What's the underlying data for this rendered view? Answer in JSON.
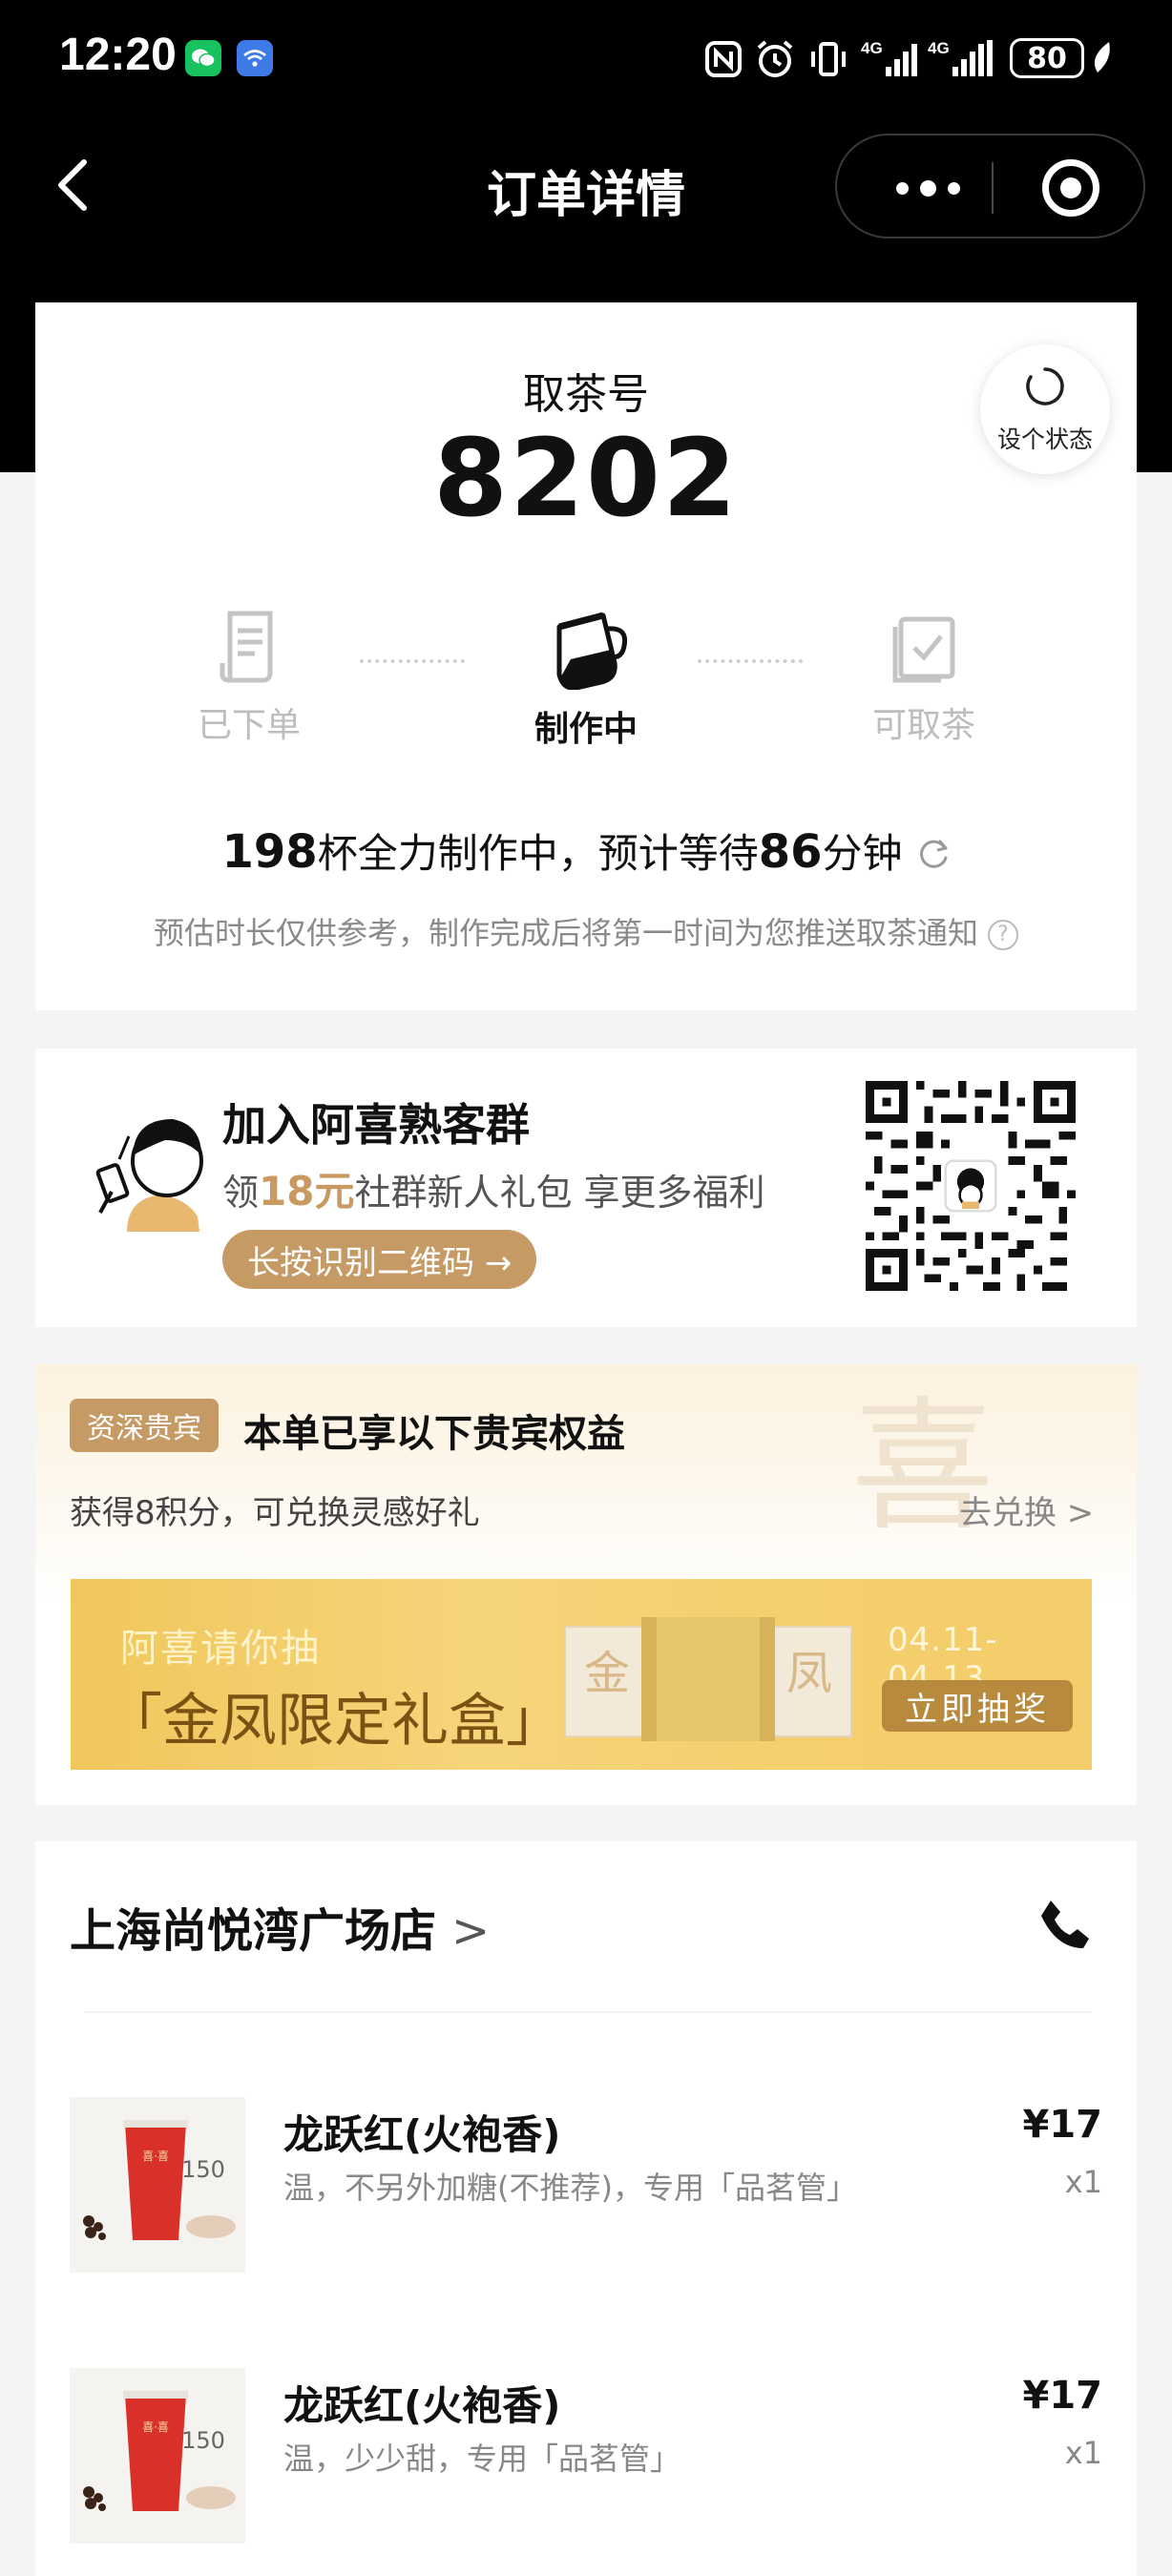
{
  "status_bar": {
    "time": "12:20",
    "battery": "80",
    "icons": [
      "wechat-icon",
      "wifi-app-icon",
      "nfc-icon",
      "alarm-icon",
      "vibrate-icon",
      "signal-4g-icon",
      "signal-4g-icon",
      "battery-icon"
    ]
  },
  "nav": {
    "title": "订单详情"
  },
  "pickup": {
    "label": "取茶号",
    "number": "8202",
    "state_button": "设个状态"
  },
  "steps": [
    {
      "label": "已下单",
      "state": "done"
    },
    {
      "label": "制作中",
      "state": "active"
    },
    {
      "label": "可取茶",
      "state": "todo"
    }
  ],
  "wait": {
    "cups": "198",
    "text1": "杯全力制作中，预计等待",
    "minutes": "86",
    "text2": "分钟",
    "note": "预估时长仅供参考，制作完成后将第一时间为您推送取茶通知"
  },
  "group": {
    "title": "加入阿喜熟客群",
    "sub_prefix": "领",
    "amount": "18元",
    "sub_suffix": "社群新人礼包 享更多福利",
    "button": "长按识别二维码 →"
  },
  "vip": {
    "badge": "资深贵宾",
    "title": "本单已享以下贵宾权益",
    "watermark": "喜",
    "points_text": "获得8积分，可兑换灵感好礼",
    "exchange_link": "去兑换 >"
  },
  "banner": {
    "small_text": "阿喜请你抽",
    "big_text": "「金凤限定礼盒」",
    "box_left": "金",
    "box_right": "凤",
    "date": "04.11-04.13",
    "button": "立即抽奖"
  },
  "store": {
    "name": "上海尚悦湾广场店",
    "chevron": ">"
  },
  "items": [
    {
      "name": "龙跃红(火袍香)",
      "options": "温，不另外加糖(不推荐)，专用「品茗管」",
      "price": "¥17",
      "qty": "x1",
      "cup_label": "150"
    },
    {
      "name": "龙跃红(火袍香)",
      "options": "温，少少甜，专用「品茗管」",
      "price": "¥17",
      "qty": "x1",
      "cup_label": "150"
    }
  ],
  "colors": {
    "accent_gold": "#c69a64",
    "banner_gold": "#f3ce6a",
    "cup_red": "#d9302a"
  }
}
